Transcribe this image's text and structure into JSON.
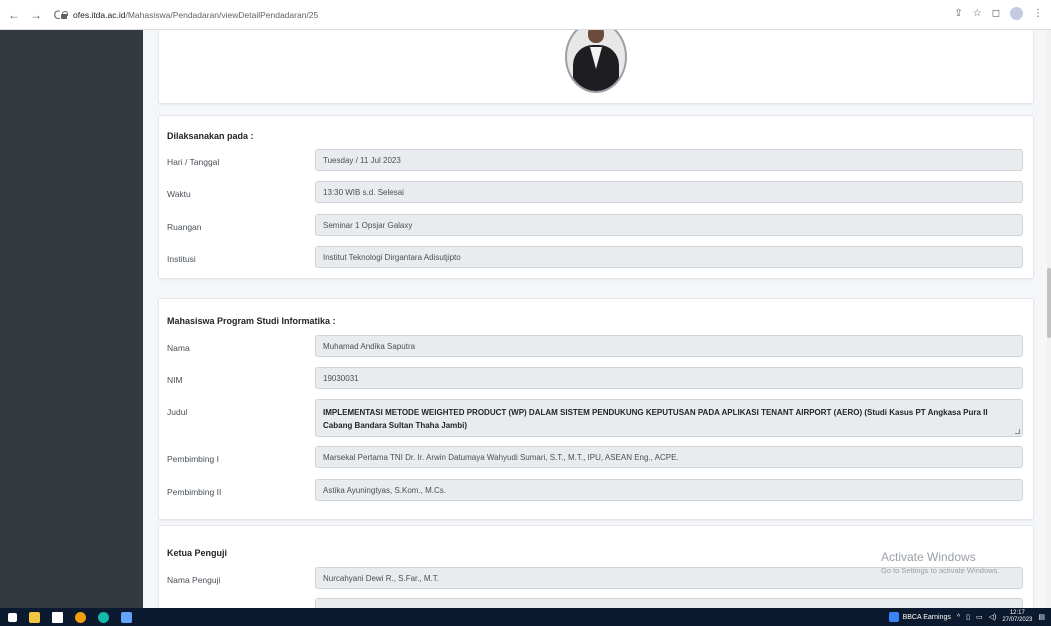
{
  "browser": {
    "url_domain": "ofes.itda.ac.id",
    "url_path": "/Mahasiswa/Pendadaran/viewDetailPendadaran/25"
  },
  "schedule": {
    "title": "Dilaksanakan pada :",
    "rows": [
      {
        "label": "Hari / Tanggal",
        "value": "Tuesday / 11 Jul 2023"
      },
      {
        "label": "Waktu",
        "value": "13:30 WIB s.d. Selesai"
      },
      {
        "label": "Ruangan",
        "value": "Seminar 1 Opsjar Galaxy"
      },
      {
        "label": "Institusi",
        "value": "Institut Teknologi Dirgantara Adisutjipto"
      }
    ]
  },
  "student": {
    "title": "Mahasiswa Program Studi Informatika :",
    "nama_label": "Nama",
    "nama": "Muhamad Andika Saputra",
    "nim_label": "NIM",
    "nim": "19030031",
    "judul_label": "Judul",
    "judul": "IMPLEMENTASI METODE WEIGHTED PRODUCT (WP) DALAM SISTEM PENDUKUNG KEPUTUSAN PADA APLIKASI TENANT AIRPORT (AERO)  (Studi Kasus PT Angkasa Pura II Cabang Bandara Sultan Thaha Jambi)",
    "pembimbing1_label": "Pembimbing I",
    "pembimbing1": "Marsekal Pertama TNI  Dr. Ir. Arwin Datumaya Wahyudi Sumari, S.T., M.T., IPU, ASEAN Eng., ACPE.",
    "pembimbing2_label": "Pembimbing II",
    "pembimbing2": "Astika Ayuningtyas, S.Kom., M.Cs."
  },
  "examiner": {
    "title": "Ketua Penguji",
    "nama_label": "Nama Penguji",
    "nama": "Nurcahyani Dewi R., S.Far., M.T."
  },
  "watermark": {
    "title": "Activate Windows",
    "subtitle": "Go to Settings to activate Windows."
  },
  "taskbar": {
    "news": "BBCA  Earnings",
    "time": "12:17",
    "date": "27/07/2023"
  }
}
